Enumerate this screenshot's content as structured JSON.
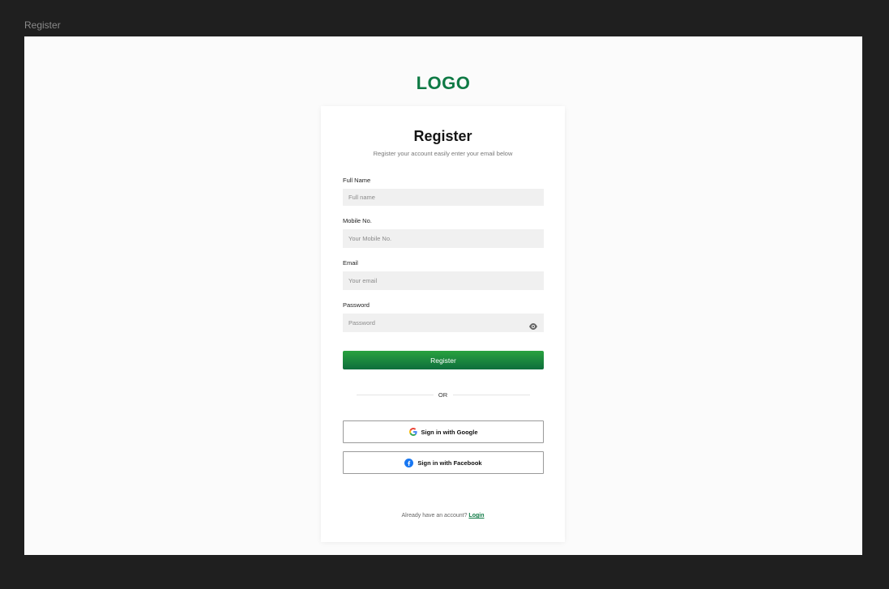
{
  "frame_label": "Register",
  "logo_text": "LOGO",
  "card": {
    "title": "Register",
    "subtitle": "Register your account easily enter your email below"
  },
  "fields": {
    "full_name": {
      "label": "Full Name",
      "placeholder": "Full name"
    },
    "mobile": {
      "label": "Mobile No.",
      "placeholder": "Your Mobile No."
    },
    "email": {
      "label": "Email",
      "placeholder": "Your email"
    },
    "password": {
      "label": "Password",
      "placeholder": "Password"
    }
  },
  "register_button": "Register",
  "divider_text": "OR",
  "google_button": "Sign in with Google",
  "facebook_button": "Sign in with Facebook",
  "footer": {
    "text": "Already have an account?",
    "link": "Login"
  },
  "colors": {
    "brand_green": "#0f7a45",
    "button_gradient_top": "#29a23f",
    "button_gradient_bottom": "#0e6e3c",
    "background": "#1f1f1f",
    "facebook_blue": "#1877f2"
  },
  "icons": [
    "eye-icon",
    "google-icon",
    "facebook-icon"
  ]
}
